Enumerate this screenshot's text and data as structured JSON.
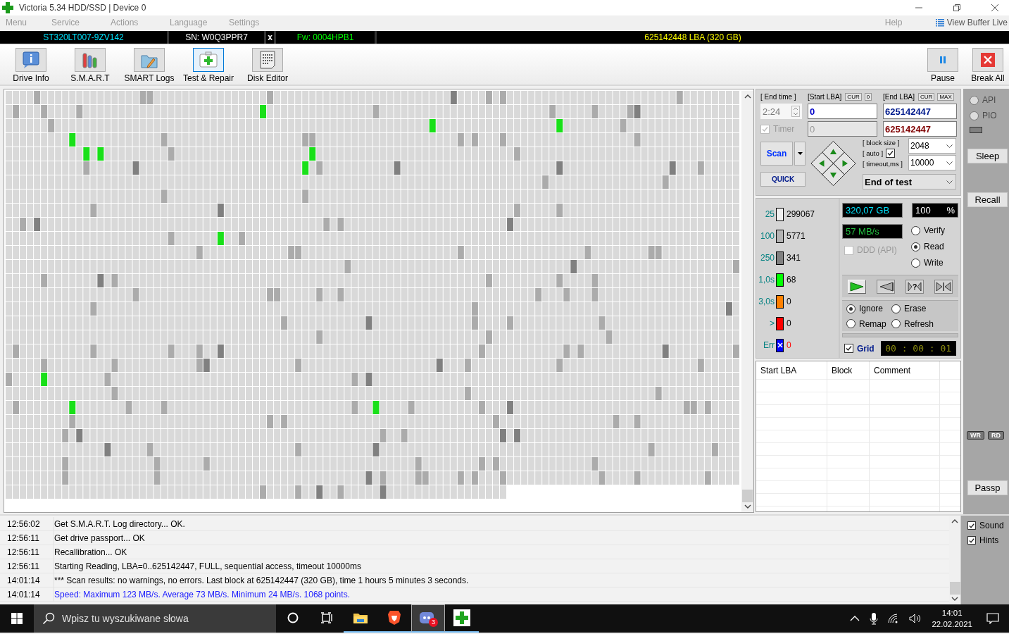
{
  "window": {
    "title": "Victoria 5.34 HDD/SSD | Device 0"
  },
  "menu": [
    "Menu",
    "Service",
    "Actions",
    "Language",
    "Settings"
  ],
  "menu_right": {
    "help": "Help",
    "view_buffer": "View Buffer Live"
  },
  "drive_bar": {
    "model": "ST320LT007-9ZV142",
    "serial": "SN: W0Q3PPR7",
    "close": "x",
    "firmware": "Fw: 0004HPB1",
    "capacity": "625142448 LBA (320 GB)"
  },
  "toolbar": [
    {
      "label": "Drive Info",
      "kind": "info",
      "selected": false
    },
    {
      "label": "S.M.A.R.T",
      "kind": "smart",
      "selected": false
    },
    {
      "label": "SMART Logs",
      "kind": "logs",
      "selected": false
    },
    {
      "label": "Test & Repair",
      "kind": "test",
      "selected": true
    },
    {
      "label": "Disk Editor",
      "kind": "editor",
      "selected": false
    }
  ],
  "toolbar_right": [
    {
      "label": "Pause",
      "kind": "pause"
    },
    {
      "label": "Break All",
      "kind": "break"
    }
  ],
  "scan": {
    "end_time_label": "[ End time ]",
    "end_time": "2:24",
    "timer": {
      "label": "Timer",
      "checked": true,
      "disabled": true
    },
    "start_lba_label": "[Start LBA]",
    "start_cur": "CUR",
    "start_zero": "0",
    "end_lba_label": "[End LBA]",
    "end_cur": "CUR",
    "end_max": "MAX",
    "start_lba": "0",
    "end_lba": "625142447",
    "start_lba_current": "0",
    "end_lba_current": "625142447",
    "scan_button": "Scan",
    "quick_button": "QUICK",
    "block_size_label": "[ block size ]",
    "auto_label": "[ auto ]",
    "auto_checked": true,
    "timeout_label": "[ timeout,ms ]",
    "block_size": "2048",
    "timeout": "10000",
    "end_action": "End of test"
  },
  "legend": [
    {
      "label": "25",
      "count": "299067",
      "color": "#f0f0f0",
      "kind": "level"
    },
    {
      "label": "100",
      "count": "5771",
      "color": "#b4b4b4",
      "kind": "level"
    },
    {
      "label": "250",
      "count": "341",
      "color": "#808080",
      "kind": "level"
    },
    {
      "label": "1,0s",
      "count": "68",
      "color": "#00ff00",
      "kind": "level"
    },
    {
      "label": "3,0s",
      "count": "0",
      "color": "#ff8000",
      "kind": "level"
    },
    {
      "label": ">",
      "count": "0",
      "color": "#ff0000",
      "kind": "level"
    },
    {
      "label": "Err",
      "count": "0",
      "color": "#0000ff",
      "kind": "error"
    }
  ],
  "status": {
    "size": "320,07 GB",
    "percent": "100",
    "percent_sign": "%",
    "speed": "57 MB/s",
    "ddd": {
      "label": "DDD (API)",
      "checked": false,
      "disabled": true
    }
  },
  "modes": [
    {
      "label": "Verify",
      "selected": false
    },
    {
      "label": "Read",
      "selected": true
    },
    {
      "label": "Write",
      "selected": false
    }
  ],
  "player": [
    {
      "kind": "play"
    },
    {
      "kind": "rewind"
    },
    {
      "kind": "query",
      "label": "?"
    },
    {
      "kind": "jump"
    }
  ],
  "repair": [
    {
      "label": "Ignore",
      "selected": true
    },
    {
      "label": "Erase",
      "selected": false
    },
    {
      "label": "Remap",
      "selected": false
    },
    {
      "label": "Refresh",
      "selected": false
    }
  ],
  "grid_toggle": {
    "label": "Grid",
    "checked": true
  },
  "elapsed": "00 : 00 : 01",
  "table": {
    "columns": [
      "Start LBA",
      "Block",
      "Comment"
    ]
  },
  "side": {
    "interface": [
      {
        "label": "API",
        "selected": false,
        "disabled": true
      },
      {
        "label": "PIO",
        "selected": false,
        "disabled": true
      }
    ],
    "sleep": "Sleep",
    "recall": "Recall",
    "indicators": [
      "WR",
      "RD"
    ],
    "passp": "Passp"
  },
  "log": [
    {
      "time": "12:56:02",
      "text": "Get S.M.A.R.T. Log directory... OK.",
      "kind": "info"
    },
    {
      "time": "12:56:11",
      "text": "Get drive passport... OK",
      "kind": "info"
    },
    {
      "time": "12:56:11",
      "text": "Recallibration... OK",
      "kind": "info"
    },
    {
      "time": "12:56:11",
      "text": "Starting Reading, LBA=0..625142447, FULL, sequential access, timeout 10000ms",
      "kind": "info"
    },
    {
      "time": "14:01:14",
      "text": "*** Scan results: no warnings, no errors. Last block at 625142447 (320 GB), time 1 hours 5 minutes 3 seconds.",
      "kind": "info"
    },
    {
      "time": "14:01:14",
      "text": "Speed: Maximum 123 MB/s. Average 73 MB/s. Minimum 24 MB/s. 1068 points.",
      "kind": "speed"
    }
  ],
  "options": [
    {
      "label": "Sound",
      "checked": true
    },
    {
      "label": "Hints",
      "checked": true
    }
  ],
  "taskbar": {
    "search": {
      "placeholder": "Wpisz tu wyszukiwane słowa"
    },
    "apps": [
      {
        "kind": "cortana",
        "running": false,
        "selected": false
      },
      {
        "kind": "taskview",
        "running": false,
        "selected": false
      },
      {
        "kind": "explorer",
        "running": true,
        "selected": false
      },
      {
        "kind": "brave",
        "running": true,
        "selected": false
      },
      {
        "kind": "discord",
        "running": true,
        "selected": true,
        "badge": "3"
      },
      {
        "kind": "victoria",
        "running": true,
        "selected": false
      }
    ],
    "time": "14:01",
    "date": "22.02.2021"
  }
}
